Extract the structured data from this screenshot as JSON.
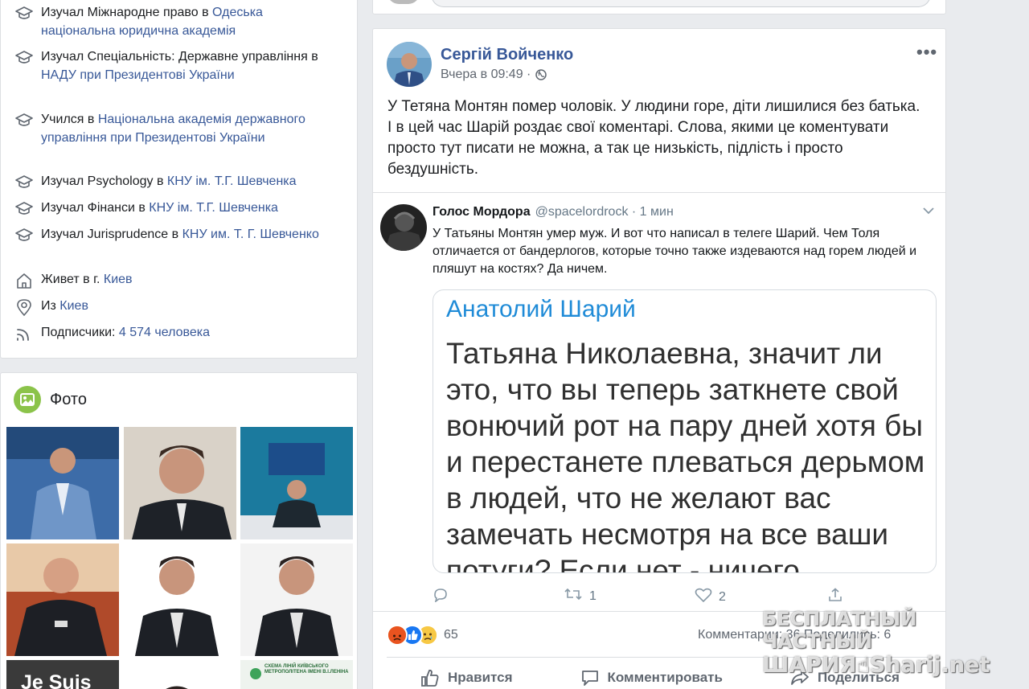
{
  "intro": {
    "items": [
      {
        "icon": "graduation-cap-icon",
        "prefix": "Изучал Міжнародне право в ",
        "link": "Одеська національна юридична академія"
      },
      {
        "icon": "graduation-cap-icon",
        "prefix": "Изучал Спеціальність: Державне управління в ",
        "link": "НАДУ при Президентові України"
      },
      {
        "icon": "graduation-cap-icon",
        "prefix": "Учился в ",
        "link": "Національна академія державного управління при Президентові України"
      },
      {
        "icon": "graduation-cap-icon",
        "prefix": "Изучал Psychology в ",
        "link": "КНУ ім. Т.Г. Шевченка"
      },
      {
        "icon": "graduation-cap-icon",
        "prefix": "Изучал Фінанси в ",
        "link": "КНУ ім. Т.Г. Шевченка"
      },
      {
        "icon": "graduation-cap-icon",
        "prefix": "Изучал Jurisprudence в ",
        "link": "КНУ им. Т. Г. Шевченко"
      },
      {
        "icon": "home-icon",
        "prefix": "Живет в г. ",
        "link": "Киев"
      },
      {
        "icon": "location-pin-icon",
        "prefix": "Из ",
        "link": "Киев"
      },
      {
        "icon": "followers-icon",
        "prefix": "Подписчики: ",
        "link": "4 574 человека"
      }
    ]
  },
  "photos": {
    "title": "Фото",
    "partial_thumb_text": "Je Suis",
    "partial_thumb_caption": "СХЕМА ЛІНІЙ КИЇВСЬКОГО МЕТРОПОЛІТЕНА ІМЕНІ В.І.ЛЕНІНА"
  },
  "post": {
    "author": "Сергій Войченко",
    "time": "Вчера в 09:49 ·",
    "text": "У Тетяна Монтян помер чоловік. У людини горе, діти лишилися без батька. І в цей час Шарій роздає свої коментарі. Слова, якими це коментувати просто тут писати не можна, а так це низькість, підлість і просто бездушність.",
    "tweet": {
      "name": "Голос Мордора",
      "handle": "@spacelordrock · 1 мин",
      "text": "У Татьяны Монтян умер муж. И вот что написал в телеге Шарий. Чем Толя отличается от бандерлогов, которые точно также издеваются над горем людей и пляшут на костях? Да ничем.",
      "quote_name": "Анатолий Шарий",
      "quote_text": "Татьяна Николаевна, значит ли это, что вы теперь заткнете свой вонючий рот на пару дней хотя бы и перестанете плеваться дерьмом в людей, что не желают вас замечать несмотря на все ваши потуги? Если нет - ничего",
      "retweets": "1",
      "likes": "2"
    },
    "reaction_count": "65",
    "counts": "Комментарии: 36  Поделились: 6",
    "actions": {
      "like": "Нравится",
      "comment": "Комментировать",
      "share": "Поделиться"
    }
  },
  "watermark": {
    "line1": "БЕСПЛАТНЫЙ ЧАСТНЫЙ",
    "line2": "ШАРИЯ☝Sharij.net"
  },
  "colors": {
    "link": "#385898",
    "photo_icon": "#8bc34a",
    "quote_name": "#1f8bd7"
  }
}
